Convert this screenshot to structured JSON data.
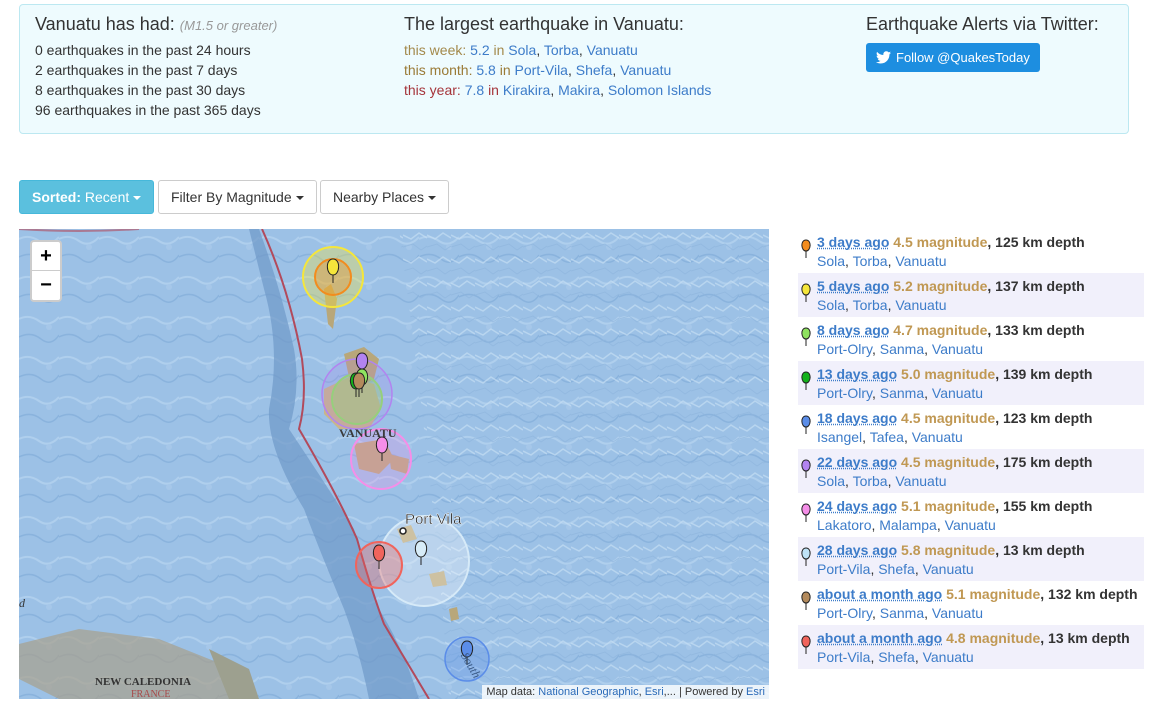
{
  "summary": {
    "had_title": "Vanuatu has had:",
    "had_sub": "(M1.5 or greater)",
    "counts": [
      "0 earthquakes in the past 24 hours",
      "2 earthquakes in the past 7 days",
      "8 earthquakes in the past 30 days",
      "96 earthquakes in the past 365 days"
    ],
    "largest_title": "The largest earthquake in Vanuatu:",
    "week": {
      "label": "this week:",
      "mag": "5.2",
      "in": "in",
      "p1": "Sola",
      "p2": "Torba",
      "p3": "Vanuatu"
    },
    "month": {
      "label": "this month:",
      "mag": "5.8",
      "in": "in",
      "p1": "Port-Vila",
      "p2": "Shefa",
      "p3": "Vanuatu"
    },
    "year": {
      "label": "this year:",
      "mag": "7.8",
      "in": "in",
      "p1": "Kirakira",
      "p2": "Makira",
      "p3": "Solomon Islands"
    },
    "alerts_title": "Earthquake Alerts via Twitter:",
    "follow_label": "Follow @QuakesToday"
  },
  "toolbar": {
    "sorted_bold": "Sorted:",
    "sorted_value": "Recent",
    "filter_label": "Filter By Magnitude",
    "nearby_label": "Nearby Places"
  },
  "map": {
    "zoom_in": "+",
    "zoom_out": "−",
    "labels": {
      "vanuatu": "VANUATU",
      "portvila": "Port Vila",
      "newcal": "NEW CALEDONIA",
      "france": "FRANCE",
      "south": "South",
      "d": "d"
    },
    "attrib_prefix": "Map data:",
    "attrib_ng": "National Geographic",
    "attrib_esri": "Esri",
    "attrib_more": "...",
    "attrib_powered": "| Powered by",
    "attrib_esri2": "Esri"
  },
  "quakes": [
    {
      "ago": "3 days ago",
      "mag": "4.5 magnitude",
      "depth": ", 125 km depth",
      "p1": "Sola",
      "p2": "Torba",
      "p3": "Vanuatu",
      "color": "#f28c1e"
    },
    {
      "ago": "5 days ago",
      "mag": "5.2 magnitude",
      "depth": ", 137 km depth",
      "p1": "Sola",
      "p2": "Torba",
      "p3": "Vanuatu",
      "color": "#f5e63b"
    },
    {
      "ago": "8 days ago",
      "mag": "4.7 magnitude",
      "depth": ", 133 km depth",
      "p1": "Port-Olry",
      "p2": "Sanma",
      "p3": "Vanuatu",
      "color": "#8fe35f"
    },
    {
      "ago": "13 days ago",
      "mag": "5.0 magnitude",
      "depth": ", 139 km depth",
      "p1": "Port-Olry",
      "p2": "Sanma",
      "p3": "Vanuatu",
      "color": "#13b11a"
    },
    {
      "ago": "18 days ago",
      "mag": "4.5 magnitude",
      "depth": ", 123 km depth",
      "p1": "Isangel",
      "p2": "Tafea",
      "p3": "Vanuatu",
      "color": "#5b8de8"
    },
    {
      "ago": "22 days ago",
      "mag": "4.5 magnitude",
      "depth": ", 175 km depth",
      "p1": "Sola",
      "p2": "Torba",
      "p3": "Vanuatu",
      "color": "#b283f0"
    },
    {
      "ago": "24 days ago",
      "mag": "5.1 magnitude",
      "depth": ", 155 km depth",
      "p1": "Lakatoro",
      "p2": "Malampa",
      "p3": "Vanuatu",
      "color": "#f58ee8"
    },
    {
      "ago": "28 days ago",
      "mag": "5.8 magnitude",
      "depth": ", 13 km depth",
      "p1": "Port-Vila",
      "p2": "Shefa",
      "p3": "Vanuatu",
      "color": "#bfe3f7"
    },
    {
      "ago": "about a month ago",
      "mag": "5.1 magnitude",
      "depth": ", 132 km depth",
      "p1": "Port-Olry",
      "p2": "Sanma",
      "p3": "Vanuatu",
      "color": "#b38a5c"
    },
    {
      "ago": "about a month ago",
      "mag": "4.8 magnitude",
      "depth": ", 13 km depth",
      "p1": "Port-Vila",
      "p2": "Shefa",
      "p3": "Vanuatu",
      "color": "#f0645c"
    }
  ]
}
